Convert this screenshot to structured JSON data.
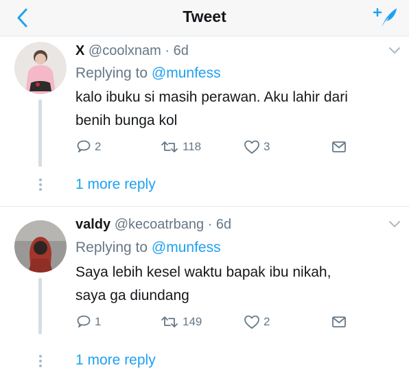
{
  "header": {
    "title": "Tweet",
    "back_icon": "chevron-left-icon",
    "compose_icon": "compose-tweet-icon",
    "accent": "#1da1f2"
  },
  "tweets": [
    {
      "display_name": "X",
      "handle": "@coolxnam",
      "time": "· 6d",
      "replying_prefix": "Replying to ",
      "replying_to": "@munfess",
      "text_lines": [
        "kalo ibuku si masih perawan. Aku lahir dari",
        "benih bunga kol"
      ],
      "replies": "2",
      "retweets": "118",
      "likes": "3",
      "more_reply": "1 more reply"
    },
    {
      "display_name": "valdy",
      "handle": "@kecoatrbang",
      "time": "· 6d",
      "replying_prefix": "Replying to ",
      "replying_to": "@munfess",
      "text_lines": [
        "Saya lebih kesel waktu bapak ibu nikah,",
        "saya ga diundang"
      ],
      "replies": "1",
      "retweets": "149",
      "likes": "2",
      "more_reply": "1 more reply"
    }
  ],
  "colors": {
    "text": "#14171a",
    "secondary": "#657786",
    "link": "#1da1f2",
    "divider": "#e1e8ed"
  }
}
